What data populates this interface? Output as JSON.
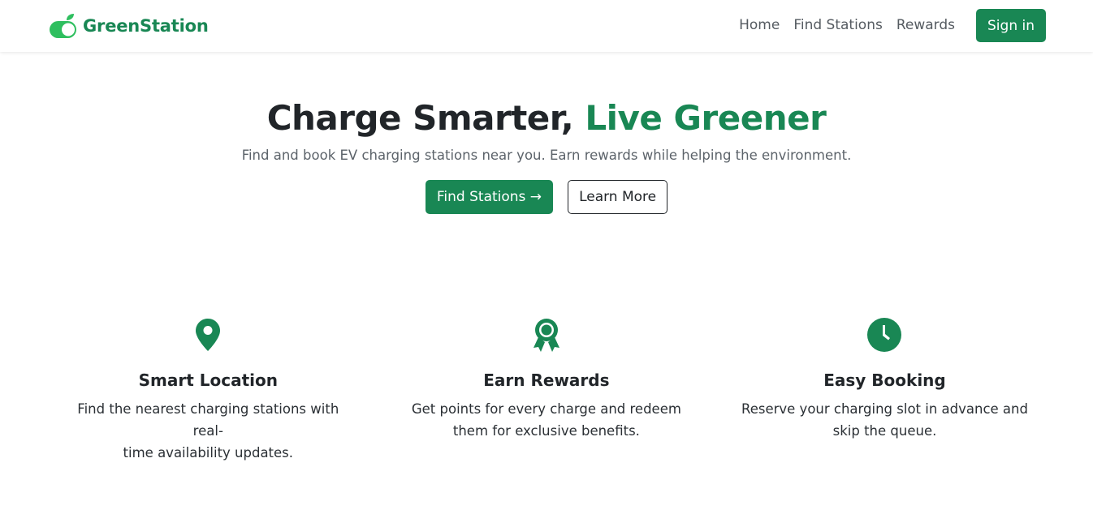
{
  "brand": {
    "name": "GreenStation",
    "color": "#198754",
    "logo_icon": "leaf-toggle-icon"
  },
  "nav": {
    "links": [
      "Home",
      "Find Stations",
      "Rewards"
    ],
    "signin_label": "Sign in"
  },
  "hero": {
    "title_main": "Charge Smarter,",
    "title_accent": "Live Greener",
    "subtitle": "Find and book EV charging stations near you. Earn rewards while helping the environment.",
    "primary_button": "Find Stations →",
    "secondary_button": "Learn More"
  },
  "features": [
    {
      "icon": "map-pin-icon",
      "title": "Smart Location",
      "desc_line1": "Find the nearest charging stations with real-",
      "desc_line2": "time availability updates."
    },
    {
      "icon": "award-icon",
      "title": "Earn Rewards",
      "desc_line1": "Get points for every charge and redeem",
      "desc_line2": "them for exclusive benefits."
    },
    {
      "icon": "clock-icon",
      "title": "Easy Booking",
      "desc_line1": "Reserve your charging slot in advance and",
      "desc_line2": "skip the queue."
    }
  ],
  "colors": {
    "accent": "#198754",
    "text": "#212529",
    "muted": "#5c636a"
  }
}
